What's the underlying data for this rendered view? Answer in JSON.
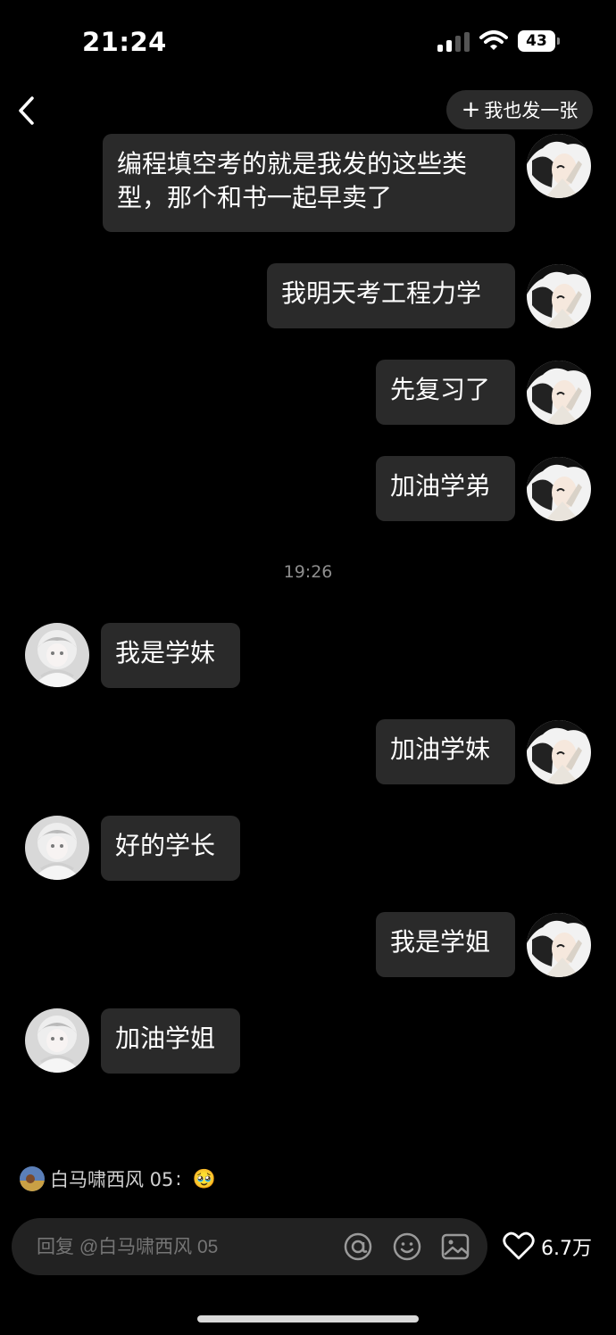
{
  "status_bar": {
    "time": "21:24",
    "battery": "43"
  },
  "header": {
    "post_button_label": "我也发一张",
    "post_button_icon": "plus-icon"
  },
  "conversation": {
    "messages": [
      {
        "side": "right",
        "text": "编程填空考的就是我发的这些类型，那个和书一起早卖了"
      },
      {
        "side": "right",
        "text": "我明天考工程力学"
      },
      {
        "side": "right",
        "text": "先复习了"
      },
      {
        "side": "right",
        "text": "加油学弟"
      },
      {
        "side": "left",
        "text": "我是学妹"
      },
      {
        "side": "right",
        "text": "加油学妹"
      },
      {
        "side": "left",
        "text": "好的学长"
      },
      {
        "side": "right",
        "text": "我是学姐"
      },
      {
        "side": "left",
        "text": "加油学姐"
      }
    ],
    "time_separator": "19:26"
  },
  "comment": {
    "author": "白马啸西风 05",
    "separator": ":",
    "emoji": "🥹"
  },
  "reply_bar": {
    "placeholder": "回复 @白马啸西风 05",
    "icons": [
      "at-icon",
      "emoji-icon",
      "image-icon"
    ],
    "like_count": "6.7万"
  },
  "colors": {
    "background": "#000000",
    "bubble": "#2a2a2a",
    "secondary_text": "#8e8e8e"
  }
}
